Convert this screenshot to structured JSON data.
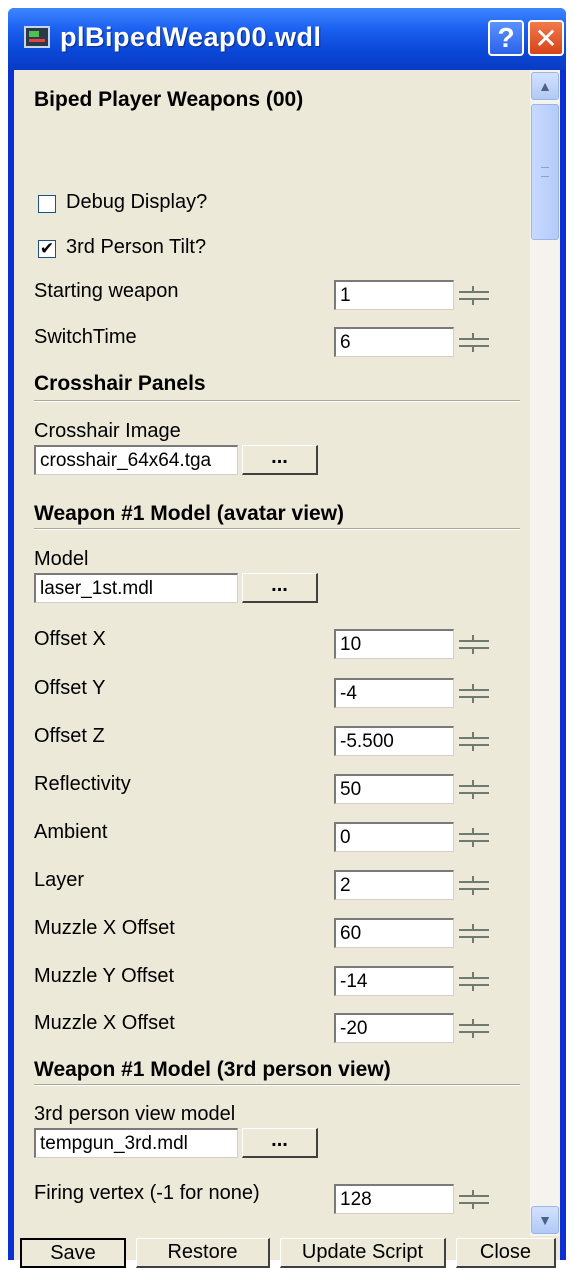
{
  "window": {
    "title": "plBipedWeap00.wdl",
    "help_glyph": "?",
    "close_glyph": "✕"
  },
  "panel": {
    "header": "Biped Player Weapons (00)",
    "debug_display": {
      "label": "Debug Display?",
      "checked": false
    },
    "third_person_tilt": {
      "label": "3rd Person Tilt?",
      "checked": true,
      "check_glyph": "✔"
    },
    "starting_weapon": {
      "label": "Starting weapon",
      "value": "1"
    },
    "switch_time": {
      "label": "SwitchTime",
      "value": "6"
    },
    "crosshair_heading": "Crosshair Panels",
    "crosshair_image": {
      "label": "Crosshair Image",
      "value": "crosshair_64x64.tga",
      "browse": "..."
    },
    "weapon1_avatar_heading": "Weapon #1 Model (avatar view)",
    "model": {
      "label": "Model",
      "value": "laser_1st.mdl",
      "browse": "..."
    },
    "offset_x": {
      "label": "Offset X",
      "value": "10"
    },
    "offset_y": {
      "label": "Offset Y",
      "value": "-4"
    },
    "offset_z": {
      "label": "Offset Z",
      "value": "-5.500"
    },
    "reflectivity": {
      "label": "Reflectivity",
      "value": "50"
    },
    "ambient": {
      "label": "Ambient",
      "value": "0"
    },
    "layer": {
      "label": "Layer",
      "value": "2"
    },
    "muzzle_x_offset": {
      "label": "Muzzle X Offset",
      "value": "60"
    },
    "muzzle_y_offset": {
      "label": "Muzzle Y Offset",
      "value": "-14"
    },
    "muzzle_x_offset_2": {
      "label": "Muzzle X Offset",
      "value": "-20"
    },
    "weapon1_3rd_heading": "Weapon #1 Model (3rd person view)",
    "third_person_model": {
      "label": "3rd person view model",
      "value": "tempgun_3rd.mdl",
      "browse": "..."
    },
    "firing_vertex": {
      "label": "Firing vertex (-1 for none)",
      "value": "128"
    }
  },
  "scrollbar": {
    "up_glyph": "▲",
    "down_glyph": "▼"
  },
  "buttons": {
    "save": "Save",
    "restore": "Restore",
    "update_script": "Update Script",
    "close": "Close"
  }
}
